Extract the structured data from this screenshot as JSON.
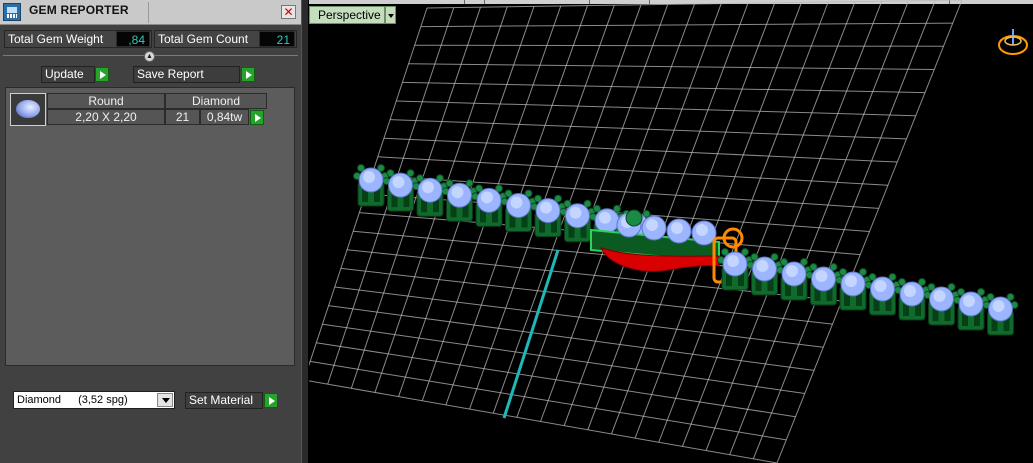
{
  "panel": {
    "title": "GEM REPORTER",
    "close_label": "✕",
    "total_weight_label": "Total Gem Weight",
    "total_weight_value": ",84",
    "total_count_label": "Total Gem Count",
    "total_count_value": "21",
    "update_label": "Update",
    "save_report_label": "Save Report",
    "gem_list": [
      {
        "shape": "Round",
        "material": "Diamond",
        "size": "2,20 X 2,20",
        "count": "21",
        "weight": "0,84tw"
      }
    ],
    "material_select": {
      "name": "Diamond",
      "density": "(3,52 spg)"
    },
    "set_material_label": "Set Material"
  },
  "viewport": {
    "view_name": "Perspective"
  },
  "colors": {
    "grid": "#b8b8b8",
    "axis": "#1fb7b7",
    "setting_green": "#0f6a2c",
    "gem_blue": "#9bb5ff",
    "selected_orange": "#ff8a00",
    "red_part": "#d80000",
    "panel_bg": "#414141",
    "value_text": "#35c7b8"
  },
  "icons": [
    "gem-reporter-icon",
    "close-icon",
    "collapse-icon",
    "play-arrow-icon",
    "round-gem-icon",
    "chevron-down-icon",
    "view-orientation-icon"
  ]
}
